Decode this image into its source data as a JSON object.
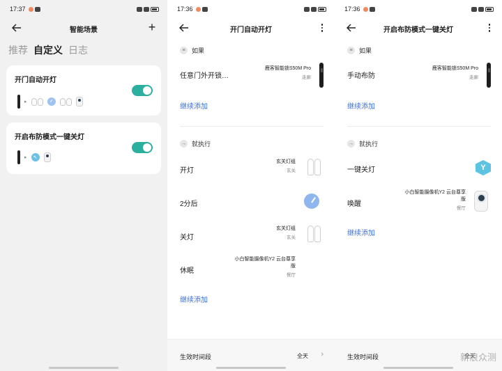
{
  "screen1": {
    "status_time": "17:37",
    "title": "智能场景",
    "tabs": [
      "推荐",
      "自定义",
      "日志"
    ],
    "active_tab": "自定义",
    "cards": [
      {
        "title": "开门自动开灯",
        "enabled": true,
        "icons": [
          "lock-icon",
          "bulb-icon",
          "clock-icon",
          "bulb-icon",
          "camera-icon"
        ]
      },
      {
        "title": "开启布防模式一键关灯",
        "enabled": true,
        "icons": [
          "lock-icon",
          "arm-icon",
          "camera-icon"
        ]
      }
    ]
  },
  "screen2": {
    "status_time": "17:36",
    "title": "开门自动开灯",
    "if_label": "如果",
    "if_row": {
      "label": "任意门外开锁…",
      "device": "鹿客智能锁S50M Pro",
      "room": "走廊"
    },
    "add_more_if": "继续添加",
    "then_label": "就执行",
    "then_rows": [
      {
        "label": "开灯",
        "device": "玄关灯组",
        "room": "玄关"
      },
      {
        "label": "2分后",
        "device": "",
        "room": ""
      },
      {
        "label": "关灯",
        "device": "玄关灯组",
        "room": "玄关"
      },
      {
        "label": "休眠",
        "device": "小白智能摄像机Y2 云台尊享版",
        "room": "餐厅"
      }
    ],
    "add_more_then": "继续添加",
    "bottom_label": "生效时间段",
    "bottom_value": "全天"
  },
  "screen3": {
    "status_time": "17:36",
    "title": "开启布防模式一键关灯",
    "if_label": "如果",
    "if_row": {
      "label": "手动布防",
      "device": "鹿客智能锁S50M Pro",
      "room": "走廊"
    },
    "add_more_if": "继续添加",
    "then_label": "就执行",
    "then_rows": [
      {
        "label": "一键关灯",
        "device": "",
        "room": ""
      },
      {
        "label": "唤醒",
        "device": "小白智能摄像机Y2 云台尊享版",
        "room": "餐厅"
      }
    ],
    "add_more_then": "继续添加",
    "bottom_label": "生效时间段",
    "bottom_value": "全天"
  },
  "watermark": "新浪众测",
  "colors": {
    "toggle_on": "#2bb0a0",
    "link": "#3c6fd0",
    "clock": "#8fb7ee"
  }
}
